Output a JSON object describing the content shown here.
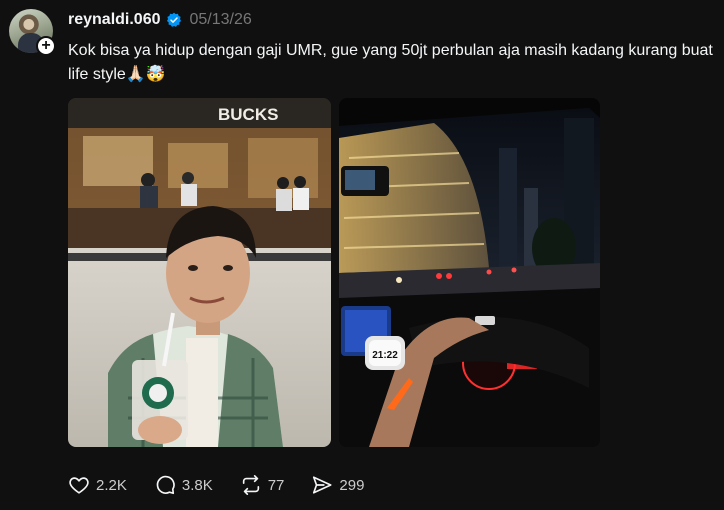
{
  "post": {
    "username": "reynaldi.060",
    "date": "05/13/26",
    "caption": "Kok bisa ya hidup dengan gaji UMR, gue yang 50jt perbulan aja masih kadang kurang buat life style🙏🏻🤯",
    "verified": true,
    "follow_symbol": "+",
    "media": [
      {
        "description_icon": "photo"
      },
      {
        "description_icon": "photo"
      }
    ],
    "store_sign_text": "BUCKS",
    "watch_time": "21:22",
    "actions": {
      "like_count": "2.2K",
      "reply_count": "3.8K",
      "repost_count": "77",
      "share_count": "299"
    }
  },
  "colors": {
    "background": "#101010",
    "text_primary": "#f3f5f7",
    "text_secondary": "#777777",
    "verified_blue": "#0095f6"
  }
}
